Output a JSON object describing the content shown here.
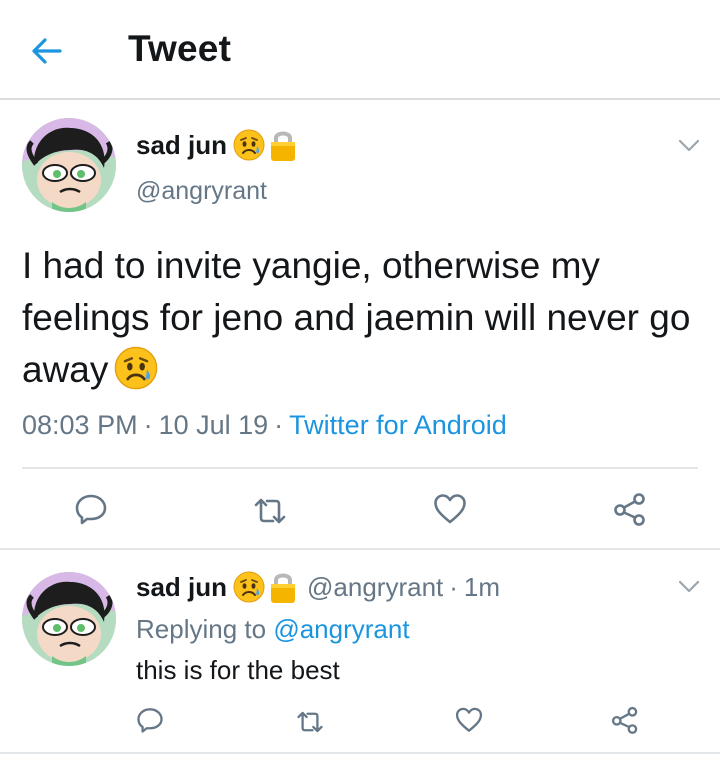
{
  "header": {
    "title": "Tweet",
    "back_icon": "arrow-left-icon"
  },
  "colors": {
    "accent": "#1b95e0",
    "secondary_text": "#657786",
    "primary_text": "#14171a"
  },
  "tweet": {
    "display_name": "sad jun",
    "handle": "@angryrant",
    "text": "I had to invite yangie, otherwise my feelings for jeno and jaemin will never go away",
    "time": "08:03 PM",
    "date": "10 Jul 19",
    "source": "Twitter for Android",
    "meta_separator": "·",
    "badges": [
      "sad-face-emoji",
      "lock-icon"
    ]
  },
  "reply": {
    "display_name": "sad jun",
    "handle": "@angryrant",
    "age": "1m",
    "separator": "·",
    "replying_prefix": "Replying to",
    "replying_to": "@angryrant",
    "text": "this is for the best"
  },
  "actions": [
    "reply-icon",
    "retweet-icon",
    "like-icon",
    "share-icon"
  ]
}
